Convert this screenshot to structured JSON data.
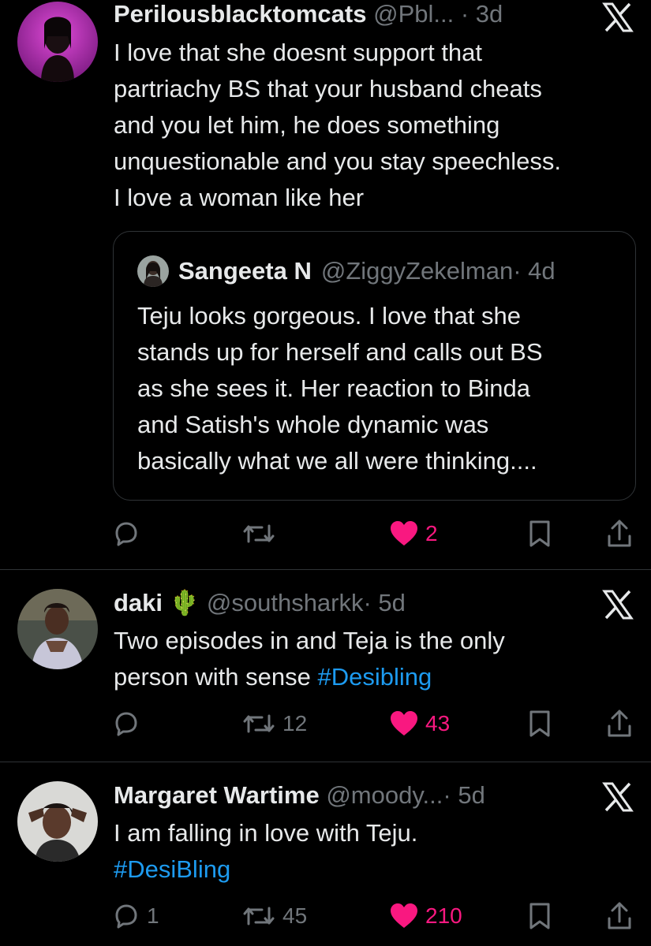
{
  "tweets": [
    {
      "name": "Perilousblacktomcats",
      "handle": "@Pbl...",
      "time": "· 3d",
      "text_lines": [
        "I love that she doesnt support that",
        "partriachy BS that your husband cheats",
        "and you let him, he does something",
        "unquestionable and you stay speechless.",
        "I love a woman like her"
      ],
      "quote": {
        "name": "Sangeeta N",
        "handle": "@ZiggyZekelman",
        "time": "· 4d",
        "text_lines": [
          "Teju looks gorgeous. I love that she",
          "stands up for herself and calls out BS",
          "as she sees it. Her reaction to Binda",
          "and Satish's whole dynamic was",
          "basically what we all were thinking...."
        ]
      },
      "replies": "",
      "reposts": "",
      "likes": "2"
    },
    {
      "name": "daki",
      "name_emoji": "🌵",
      "handle": "@southsharkk",
      "time": "· 5d",
      "text_line1": "Two episodes in and Teja is the only",
      "text_line2_prefix": "person with sense ",
      "hashtag": "#Desibling",
      "replies": "",
      "reposts": "12",
      "likes": "43"
    },
    {
      "name": "Margaret Wartime",
      "handle": "@moody...",
      "time": "· 5d",
      "text_line1": "I am falling in love with Teju.",
      "hashtag": "#DesiBling",
      "replies": "1",
      "reposts": "45",
      "likes": "210"
    }
  ],
  "colors": {
    "background": "#000000",
    "text": "#e7e9ea",
    "secondary": "#71767b",
    "like": "#f91880",
    "link": "#1d9bf0",
    "divider": "#2f3336"
  },
  "icons": [
    "x-logo-icon",
    "reply-icon",
    "repost-icon",
    "heart-icon",
    "bookmark-icon",
    "share-icon"
  ]
}
